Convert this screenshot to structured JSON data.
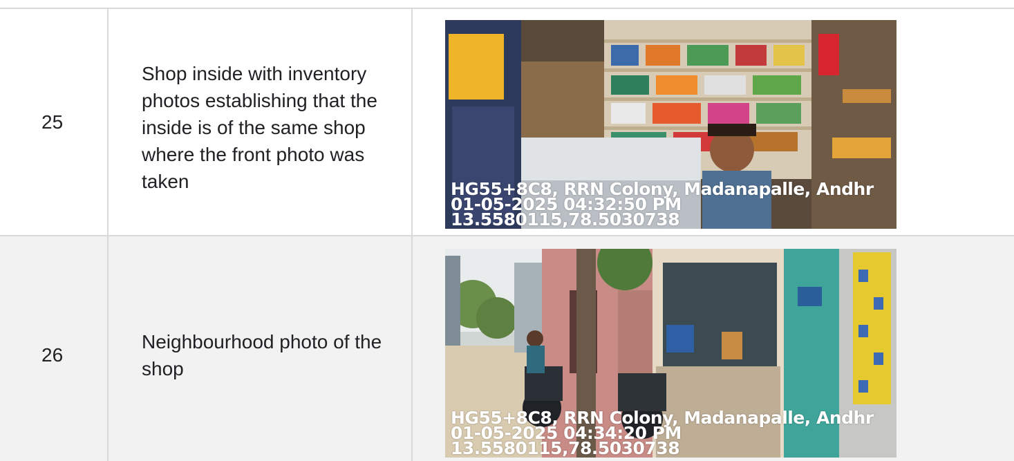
{
  "rows": [
    {
      "number": "25",
      "description": "Shop inside with inventory photos establishing that the inside is of the same shop where the front photo was taken",
      "photo": {
        "subject": "shop-interior-icon",
        "stamp_address": "HG55+8C8, RRN Colony, Madanapalle, Andhr",
        "stamp_datetime": "01-05-2025 04:32:50 PM",
        "stamp_coords": "13.5580115,78.5030738"
      }
    },
    {
      "number": "26",
      "description": "Neighbourhood photo of the shop",
      "photo": {
        "subject": "street-view-icon",
        "stamp_address": "HG55+8C8, RRN Colony, Madanapalle, Andhr",
        "stamp_datetime": "01-05-2025 04:34:20 PM",
        "stamp_coords": "13.5580115,78.5030738"
      }
    }
  ],
  "colors": {
    "border": "#d9d9d9",
    "row_alt": "#f2f2f2"
  }
}
